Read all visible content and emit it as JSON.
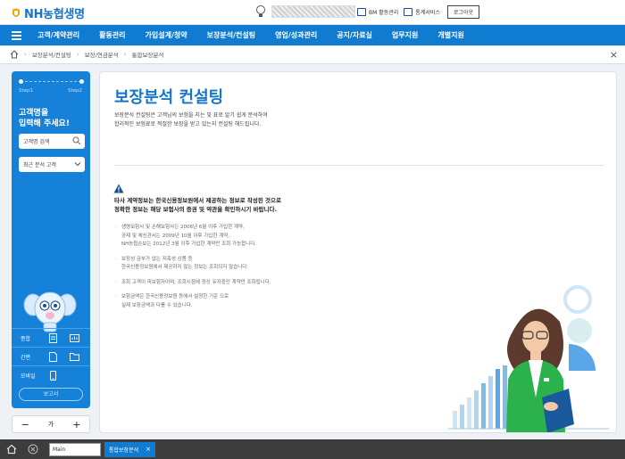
{
  "header": {
    "logo_text": "NH농협생명",
    "bm_label": "BM 활동관리",
    "call_label": "통계서비스",
    "logout_label": "로그아웃"
  },
  "nav": {
    "items": [
      "고객/계약관리",
      "활동관리",
      "가입설계/청약",
      "보장분석/컨설팅",
      "영업/성과관리",
      "공지/자료실",
      "업무지원",
      "개별지원"
    ]
  },
  "breadcrumb": {
    "items": [
      "홈",
      "보장분석/컨설팅",
      "보장/연금분석",
      "통합보장분석"
    ]
  },
  "left_panel": {
    "step1": "Step1",
    "step2": "Step2",
    "title_line1": "고객명을",
    "title_line2": "입력해 주세요!",
    "search_placeholder": "고객명 검색",
    "select_value": "최근 분석 고객",
    "menu": [
      {
        "label": "종합"
      },
      {
        "label": "간편"
      },
      {
        "label": "모바일"
      }
    ],
    "report_label": "보고서"
  },
  "font_bar": {
    "minus": "−",
    "mid": "가",
    "plus": "+"
  },
  "main": {
    "title": "보장분석 컨설팅",
    "desc_line1": "보장분석 컨설팅은 고객님의 보험을 지는 및 표로 알기 쉽게 분석하여",
    "desc_line2": "합리적인 보험료로 적절한 보장을 받고 있는지 컨설팅 해드립니다.",
    "warning_line1": "타사 계약정보는 한국신용정보원에서 제공하는 정보로 작성된 것으로",
    "warning_line2": "정확한 정보는 해당 보험사의 증권 및 약관을 확인하시기 바랍니다.",
    "notes": [
      [
        "생명보험사 및 손해보험사는 2006년 6월 이후 가입한 계약,",
        "공제 및 체신관서는 2009년 10월 이후 가입한 계약,",
        "NH농협손보는 2012년 3월 이후 가입한 계약만 조회 가능합니다."
      ],
      [
        "보장성 금부가 없는 저축성 상품 등",
        "한국신용정보원에서 제공하지 않는 정보는 조회되지 않습니다."
      ],
      [
        "조회 고객이 피보험자이며, 조회시점에 정상 유지중인 계약만 조회됩니다."
      ],
      [
        "보험금액은 한국신용정보원 등에서 설정한 기준 으로",
        "실제 보장금액과 다를 수 있습니다."
      ]
    ]
  },
  "taskbar": {
    "input_value": "Main",
    "tab_label": "통합보장분석",
    "tab_close": "×"
  },
  "colors": {
    "brand_blue": "#0f7bd1",
    "panel_blue": "#1681d9",
    "title_blue": "#1476c9"
  }
}
